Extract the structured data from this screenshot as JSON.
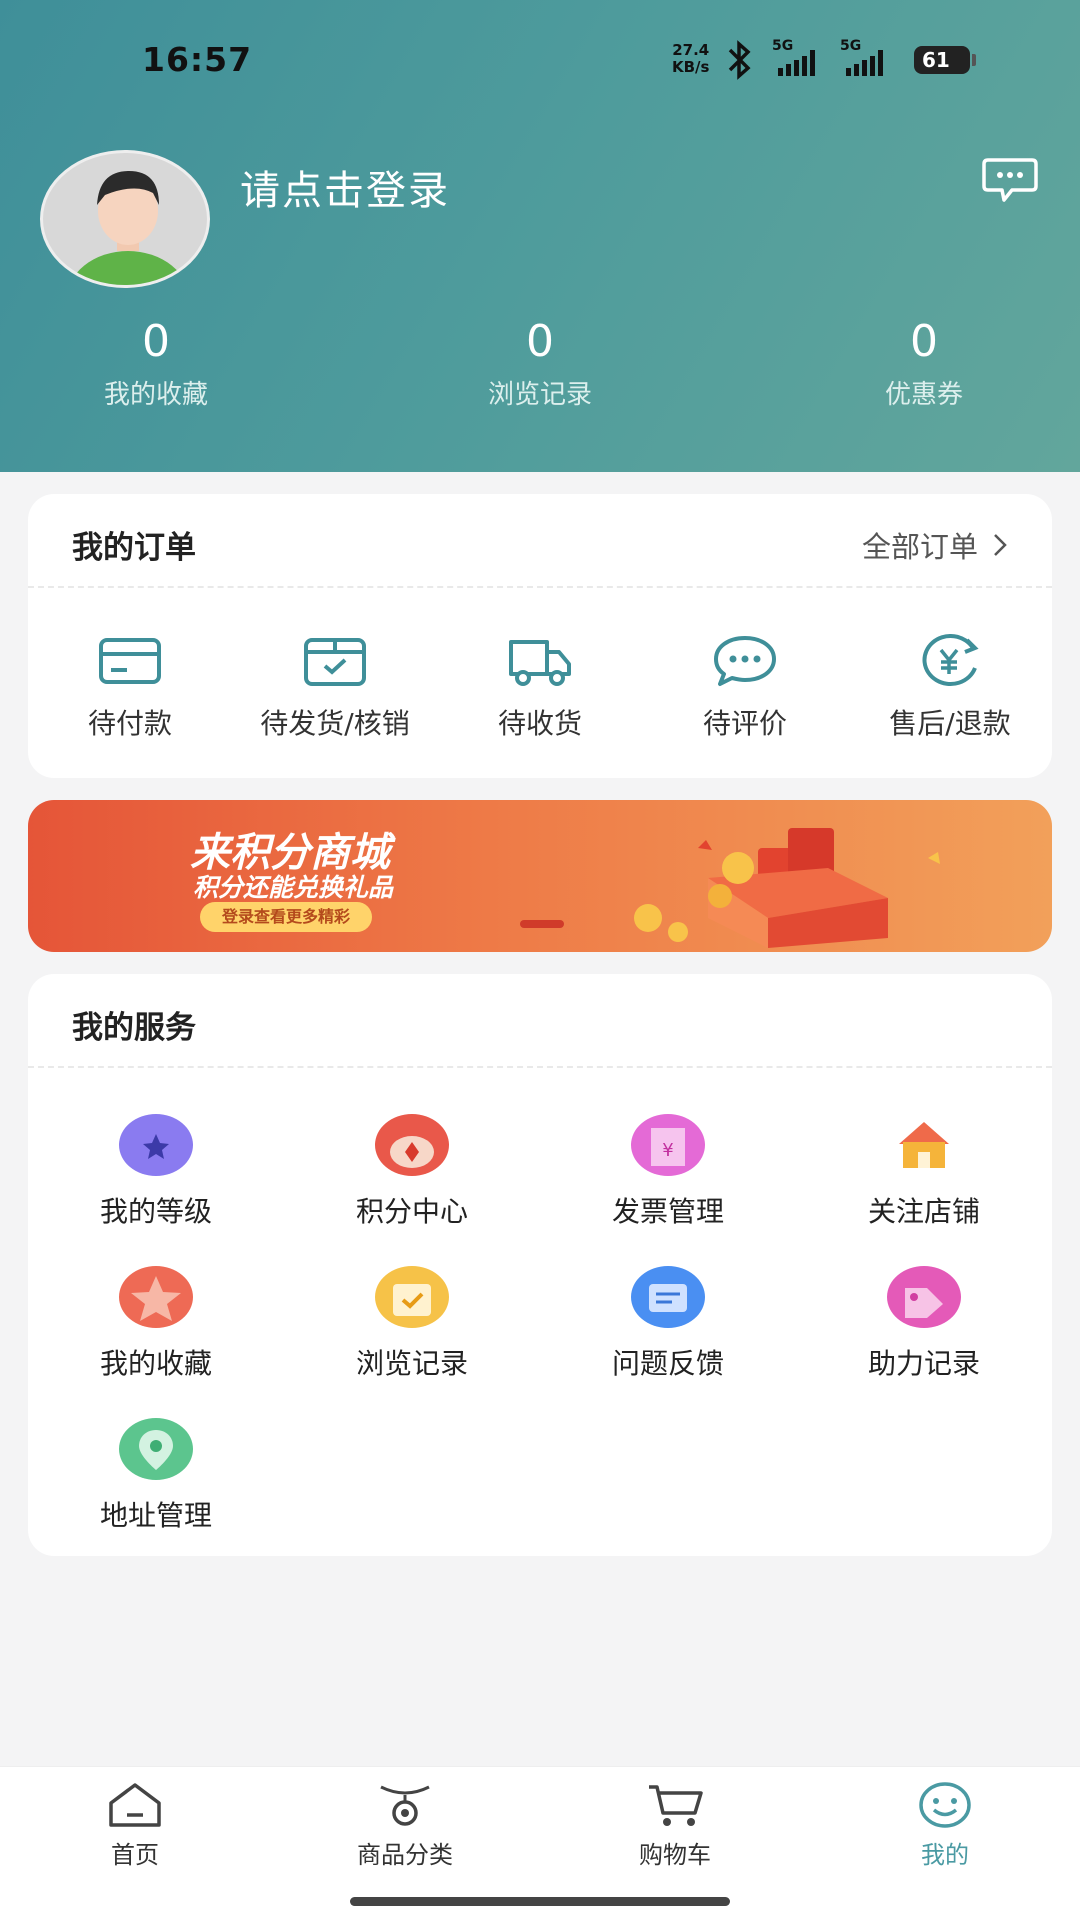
{
  "status_bar": {
    "time": "16:57",
    "net_speed_value": "27.4",
    "net_speed_unit": "KB/s",
    "sig1": "5G",
    "sig2": "5G",
    "battery": "61"
  },
  "profile": {
    "login_text": "请点击登录"
  },
  "stats": [
    {
      "value": "0",
      "label": "我的收藏"
    },
    {
      "value": "0",
      "label": "浏览记录"
    },
    {
      "value": "0",
      "label": "优惠券"
    }
  ],
  "orders": {
    "title": "我的订单",
    "all_label": "全部订单",
    "items": [
      {
        "label": "待付款",
        "icon": "wallet-icon"
      },
      {
        "label": "待发货/核销",
        "icon": "package-check-icon"
      },
      {
        "label": "待收货",
        "icon": "truck-icon"
      },
      {
        "label": "待评价",
        "icon": "chat-bubble-icon"
      },
      {
        "label": "售后/退款",
        "icon": "refund-icon"
      }
    ]
  },
  "banner": {
    "title": "来积分商城",
    "subtitle": "积分还能兑换礼品",
    "button": "登录查看更多精彩"
  },
  "services": {
    "title": "我的服务",
    "items": [
      {
        "label": "我的等级",
        "icon": "medal-icon",
        "color": "#8a7bf0"
      },
      {
        "label": "积分中心",
        "icon": "points-icon",
        "color": "#e9584a"
      },
      {
        "label": "发票管理",
        "icon": "invoice-icon",
        "color": "#e46ad6"
      },
      {
        "label": "关注店铺",
        "icon": "shop-icon",
        "color": "#f5a623"
      },
      {
        "label": "我的收藏",
        "icon": "star-icon",
        "color": "#ee6a55"
      },
      {
        "label": "浏览记录",
        "icon": "calendar-icon",
        "color": "#f6c248"
      },
      {
        "label": "问题反馈",
        "icon": "feedback-icon",
        "color": "#4a8ff2"
      },
      {
        "label": "助力记录",
        "icon": "tag-icon",
        "color": "#e45ab8"
      },
      {
        "label": "地址管理",
        "icon": "location-icon",
        "color": "#5cc58e"
      }
    ]
  },
  "tabs": [
    {
      "label": "首页",
      "icon": "home-icon"
    },
    {
      "label": "商品分类",
      "icon": "category-icon"
    },
    {
      "label": "购物车",
      "icon": "cart-icon"
    },
    {
      "label": "我的",
      "icon": "smile-icon",
      "active": true
    }
  ],
  "colors": {
    "header": "#4f9c9c",
    "accent": "#4a9aa3"
  }
}
